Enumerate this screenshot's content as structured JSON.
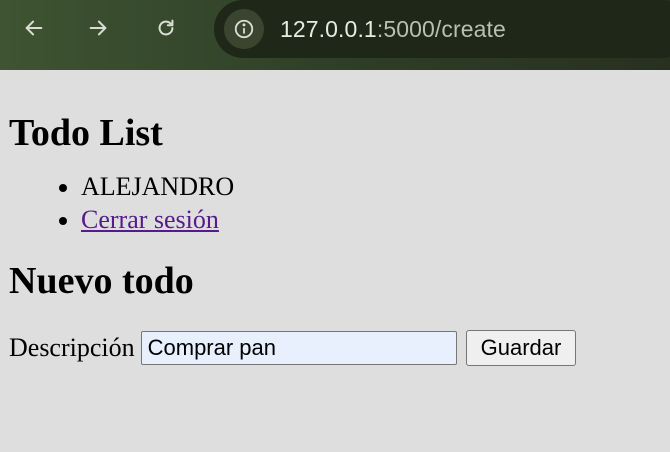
{
  "browser": {
    "url_host": "127.0.0.1",
    "url_rest": ":5000/create",
    "icons": {
      "back": "back-arrow-icon",
      "forward": "forward-arrow-icon",
      "reload": "reload-icon",
      "info": "info-icon"
    }
  },
  "page": {
    "title": "Todo List",
    "nav": {
      "user": "ALEJANDRO",
      "logout": "Cerrar sesión"
    },
    "form": {
      "heading": "Nuevo todo",
      "description_label": "Descripción",
      "description_value": "Comprar pan",
      "submit_label": "Guardar"
    }
  }
}
